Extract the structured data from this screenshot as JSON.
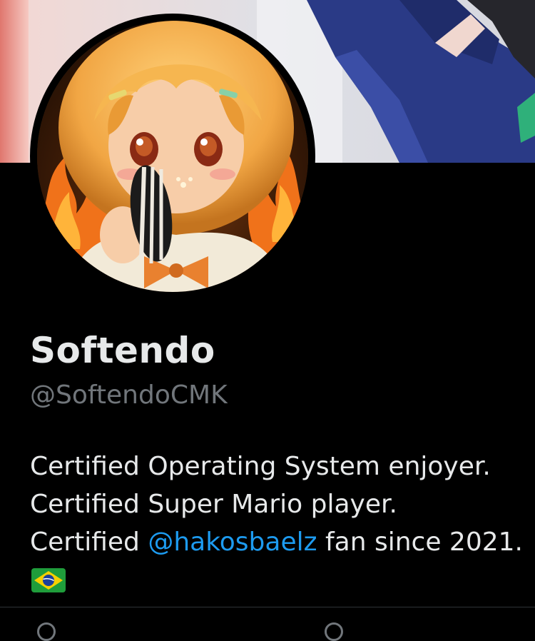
{
  "profile": {
    "display_name": "Softendo",
    "handle": "@SoftendoCMK",
    "bio": {
      "line1": "Certified Operating System enjoyer.",
      "line2": "Certified Super Mario player.",
      "line3_prefix": "Certified ",
      "line3_mention": "@hakosbaelz",
      "line3_suffix": " fan since 2021."
    },
    "flag": "brazil-flag"
  },
  "colors": {
    "background": "#000000",
    "name_text": "#e7e9ea",
    "handle_text": "#71767b",
    "mention_link": "#1d9bf0",
    "divider": "#2f3336"
  }
}
